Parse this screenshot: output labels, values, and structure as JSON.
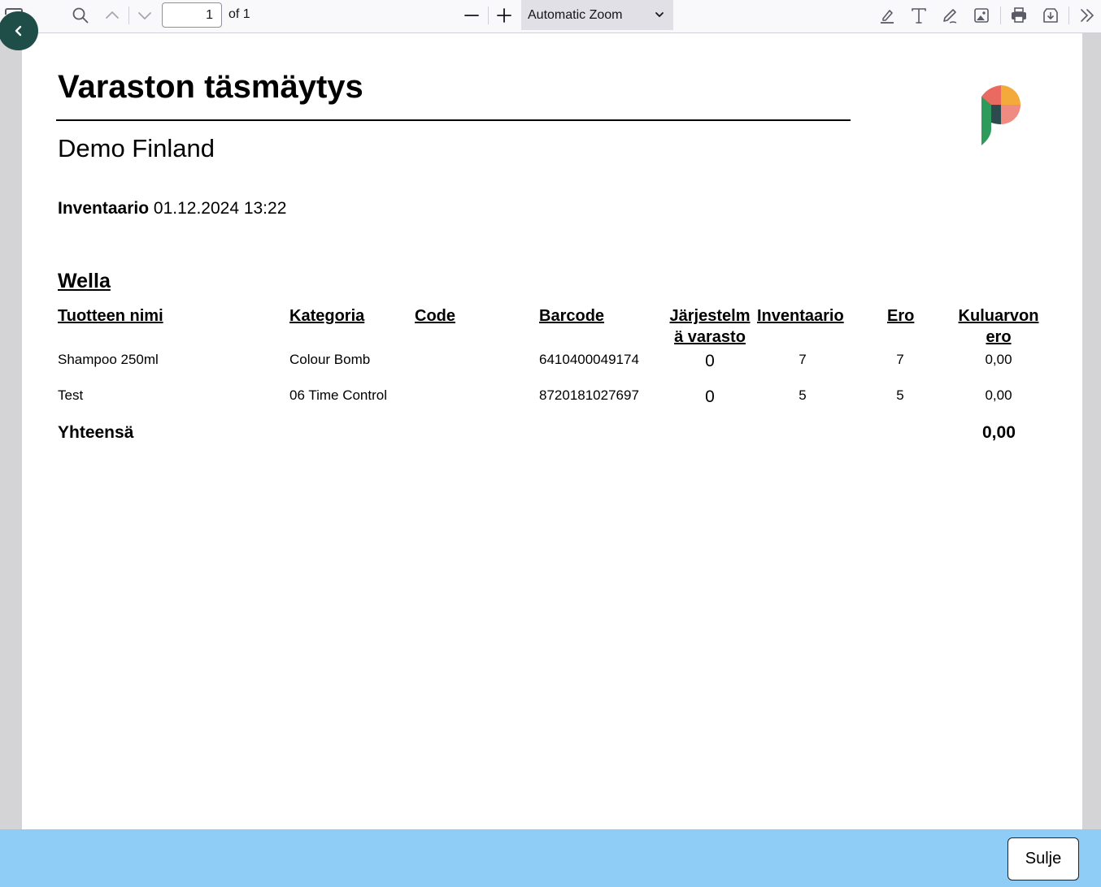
{
  "toolbar": {
    "page_number": "1",
    "page_of": "of 1",
    "zoom": "Automatic Zoom"
  },
  "document": {
    "title": "Varaston täsmäytys",
    "company": "Demo Finland",
    "inventory_label": "Inventaario",
    "inventory_datetime": "01.12.2024 13:22",
    "group": "Wella",
    "columns": {
      "name": "Tuotteen nimi",
      "category": "Kategoria",
      "code": "Code",
      "barcode": "Barcode",
      "system_stock_1": "Järjestelm",
      "system_stock_2": "ä varasto",
      "inventory": "Inventaario",
      "diff": "Ero",
      "cost_diff_1": "Kuluarvon",
      "cost_diff_2": "ero"
    },
    "rows": [
      {
        "name": "Shampoo 250ml",
        "category": "Colour Bomb",
        "code": "",
        "barcode": "6410400049174",
        "system_stock": "0",
        "inventory": "7",
        "diff": "7",
        "cost_diff": "0,00"
      },
      {
        "name": "Test",
        "category": "06 Time Control",
        "code": "",
        "barcode": "8720181027697",
        "system_stock": "0",
        "inventory": "5",
        "diff": "5",
        "cost_diff": "0,00"
      }
    ],
    "total_label": "Yhteensä",
    "total_value": "0,00"
  },
  "footer": {
    "close_label": "Sulje"
  },
  "colors": {
    "back_button": "#1f4d48",
    "footer_bg": "#8fcdf7",
    "logo_green": "#2e9a5c",
    "logo_orange": "#f4a93b",
    "logo_pink": "#f08b82",
    "logo_dark": "#2d4a4f"
  },
  "icons": [
    "sidebar-icon",
    "back-chevron-icon",
    "search-icon",
    "chevron-up-icon",
    "chevron-down-icon",
    "zoom-out-icon",
    "zoom-in-icon",
    "highlight-icon",
    "text-icon",
    "draw-icon",
    "image-icon",
    "print-icon",
    "download-icon",
    "more-tools-icon"
  ]
}
